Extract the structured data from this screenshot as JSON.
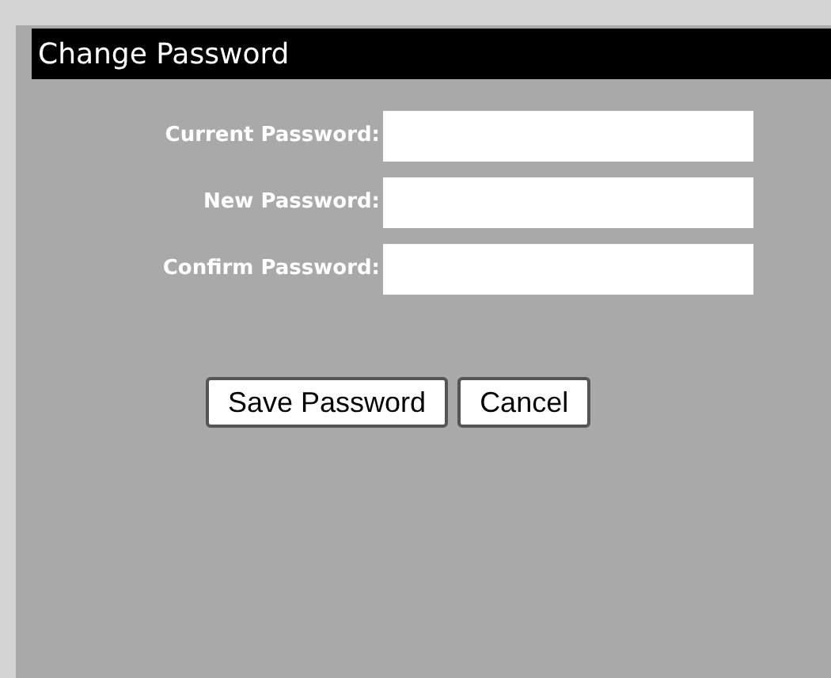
{
  "window": {
    "title": "Change Password"
  },
  "fields": [
    {
      "label": "Current Password:"
    },
    {
      "label": "New Password:"
    },
    {
      "label": "Confirm Password:"
    }
  ],
  "buttons": [
    "Save Password",
    "Cancel"
  ]
}
